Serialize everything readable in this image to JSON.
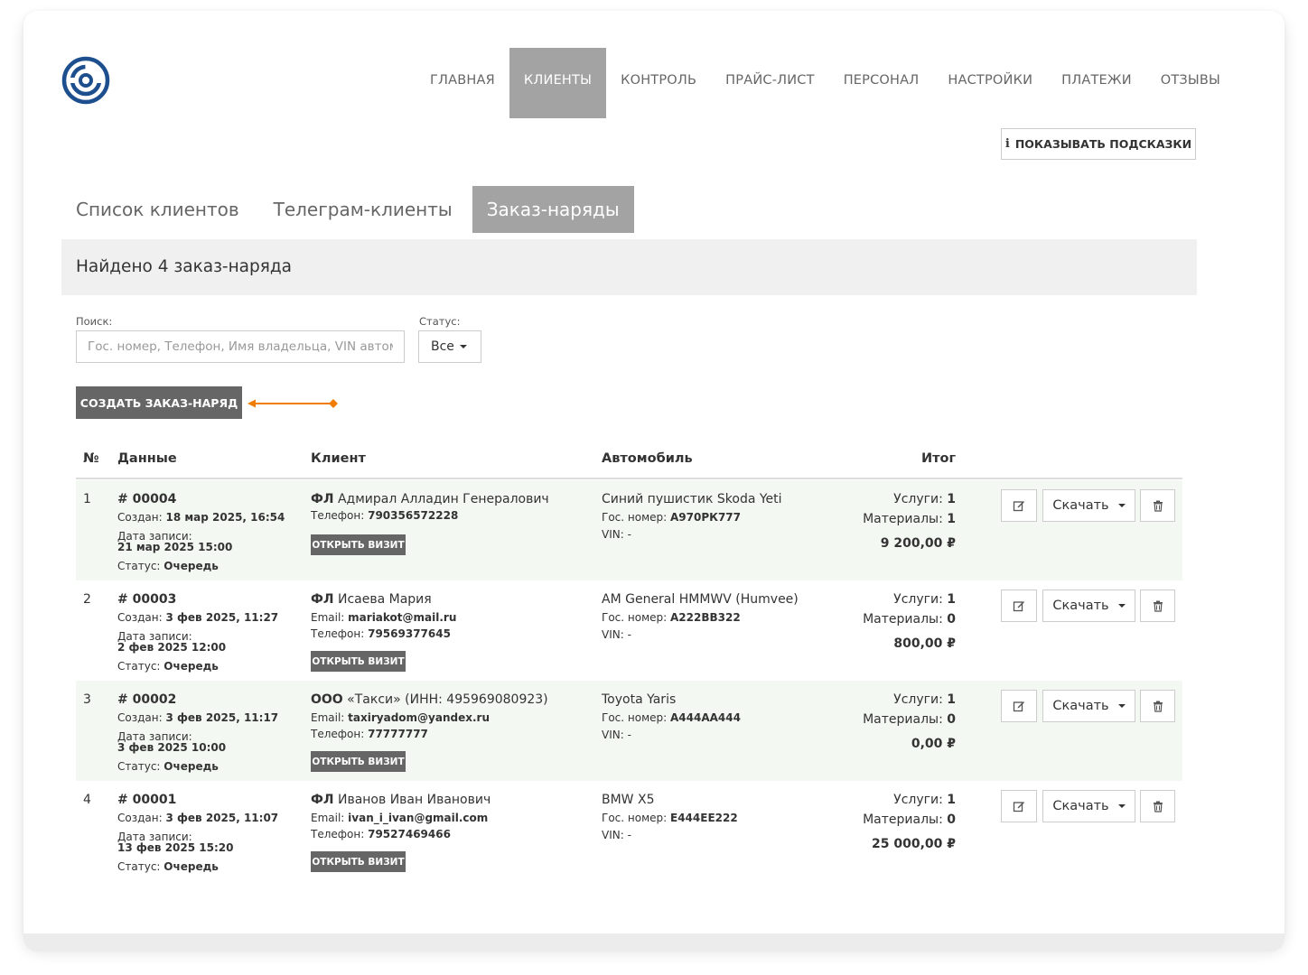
{
  "nav": {
    "items": [
      {
        "label": "Главная",
        "active": false
      },
      {
        "label": "Клиенты",
        "active": true
      },
      {
        "label": "Контроль",
        "active": false
      },
      {
        "label": "Прайс-лист",
        "active": false
      },
      {
        "label": "Персонал",
        "active": false
      },
      {
        "label": "Настройки",
        "active": false
      },
      {
        "label": "Платежи",
        "active": false
      },
      {
        "label": "Отзывы",
        "active": false
      }
    ]
  },
  "hints_button": {
    "icon": "info-icon",
    "glyph": "i",
    "label": "ПОКАЗЫВАТЬ ПОДСКАЗКИ"
  },
  "tabs": [
    {
      "label": "Список клиентов",
      "active": false
    },
    {
      "label": "Телеграм-клиенты",
      "active": false
    },
    {
      "label": "Заказ-наряды",
      "active": true
    }
  ],
  "found_text": "Найдено 4 заказ-наряда",
  "filters": {
    "search_label": "Поиск:",
    "search_placeholder": "Гос. номер, Телефон, Имя владельца, VIN автомобиля",
    "search_value": "",
    "status_label": "Статус:",
    "status_value": "Все"
  },
  "create_button": "Создать заказ-наряд",
  "table": {
    "headers": {
      "num": "№",
      "data": "Данные",
      "client": "Клиент",
      "car": "Автомобиль",
      "total": "Итог"
    },
    "labels": {
      "created": "Создан:",
      "booking": "Дата записи:",
      "status": "Статус:",
      "email": "Email:",
      "phone": "Телефон:",
      "plate": "Гос. номер:",
      "vin": "VIN:",
      "services": "Услуги:",
      "materials": "Материалы:",
      "open_visit": "Открыть визит",
      "download": "Скачать"
    },
    "rows": [
      {
        "num": "1",
        "order": "# 00004",
        "created": "18 мар 2025, 16:54",
        "booking": "21 мар 2025 15:00",
        "status": "Очередь",
        "client_type": "ФЛ",
        "client_name": "Адмирал Алладин Генералович",
        "email": "",
        "phone": "790356572228",
        "car": "Синий пушистик Skoda Yeti",
        "plate": "А970РК777",
        "vin": "-",
        "services": "1",
        "materials": "1",
        "total": "9 200,00 ₽"
      },
      {
        "num": "2",
        "order": "# 00003",
        "created": "3 фев 2025, 11:27",
        "booking": "2 фев 2025 12:00",
        "status": "Очередь",
        "client_type": "ФЛ",
        "client_name": "Исаева Мария",
        "email": "mariakot@mail.ru",
        "phone": "79569377645",
        "car": "AM General HMMWV (Humvee)",
        "plate": "А222ВВ322",
        "vin": "-",
        "services": "1",
        "materials": "0",
        "total": "800,00 ₽"
      },
      {
        "num": "3",
        "order": "# 00002",
        "created": "3 фев 2025, 11:17",
        "booking": "3 фев 2025 10:00",
        "status": "Очередь",
        "client_type": "ООО",
        "client_name": "«Такси» (ИНН: 495969080923)",
        "email": "taxiryadom@yandex.ru",
        "phone": "77777777",
        "car": "Toyota Yaris",
        "plate": "А444АА444",
        "vin": "-",
        "services": "1",
        "materials": "0",
        "total": "0,00 ₽"
      },
      {
        "num": "4",
        "order": "# 00001",
        "created": "3 фев 2025, 11:07",
        "booking": "13 фев 2025 15:20",
        "status": "Очередь",
        "client_type": "ФЛ",
        "client_name": "Иванов Иван Иванович",
        "email": "ivan_i_ivan@gmail.com",
        "phone": "79527469466",
        "car": "BMW X5",
        "plate": "Е444ЕЕ222",
        "vin": "-",
        "services": "1",
        "materials": "0",
        "total": "25 000,00 ₽"
      }
    ]
  },
  "icons": {
    "edit": "edit-icon",
    "trash": "trash-icon",
    "caret": "caret-down-icon",
    "logo": "logo-icon",
    "arrow": "orange-arrow-annotation"
  },
  "colors": {
    "active_nav": "#a3a3a3",
    "button_dark": "#666666",
    "annotation_arrow": "#f07c00",
    "striped_row": "#f4f8f2"
  }
}
